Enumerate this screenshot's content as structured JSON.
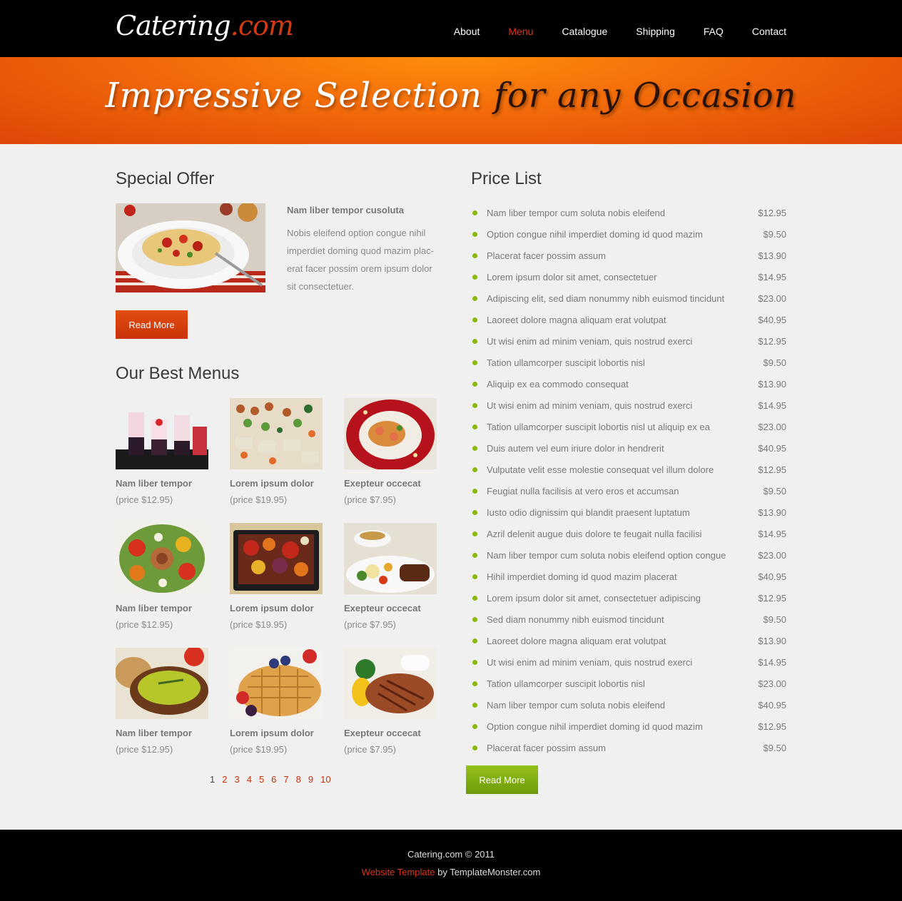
{
  "header": {
    "logo_main": "Catering",
    "logo_suffix": ".com",
    "nav": [
      {
        "label": "About",
        "active": false
      },
      {
        "label": "Menu",
        "active": true
      },
      {
        "label": "Catalogue",
        "active": false
      },
      {
        "label": "Shipping",
        "active": false
      },
      {
        "label": "FAQ",
        "active": false
      },
      {
        "label": "Contact",
        "active": false
      }
    ]
  },
  "banner": {
    "part1": "Impressive Selection",
    "part2": "for any Occasion"
  },
  "special_offer": {
    "heading": "Special Offer",
    "title": "Nam liber tempor cusoluta",
    "text": "Nobis eleifend option congue nihil imperdiet doming quod mazim plac-erat facer possim orem ipsum dolor sit consectetuer.",
    "button": "Read More"
  },
  "best_menus": {
    "heading": "Our Best Menus",
    "items": [
      {
        "name": "Nam liber tempor",
        "price": "(price $12.95)",
        "image": "dessert-glasses"
      },
      {
        "name": "Lorem ipsum dolor",
        "price": "(price $19.95)",
        "image": "canape-platter"
      },
      {
        "name": "Exepteur occecat",
        "price": "(price $7.95)",
        "image": "shrimp-plate"
      },
      {
        "name": "Nam liber tempor",
        "price": "(price $12.95)",
        "image": "vegetable-salad"
      },
      {
        "name": "Lorem ipsum dolor",
        "price": "(price $19.95)",
        "image": "roasted-vegetables"
      },
      {
        "name": "Exepteur occecat",
        "price": "(price $7.95)",
        "image": "steak-gravy"
      },
      {
        "name": "Nam liber tempor",
        "price": "(price $12.95)",
        "image": "green-soup"
      },
      {
        "name": "Lorem ipsum dolor",
        "price": "(price $19.95)",
        "image": "waffles-berries"
      },
      {
        "name": "Exepteur occecat",
        "price": "(price $7.95)",
        "image": "grilled-chicken"
      }
    ],
    "pages": [
      "1",
      "2",
      "3",
      "4",
      "5",
      "6",
      "7",
      "8",
      "9",
      "10"
    ],
    "current_page": "1"
  },
  "price_list": {
    "heading": "Price List",
    "items": [
      {
        "name": "Nam liber tempor cum soluta nobis eleifend",
        "price": "$12.95"
      },
      {
        "name": "Option congue nihil imperdiet doming id quod mazim",
        "price": "$9.50"
      },
      {
        "name": "Placerat facer possim assum",
        "price": "$13.90"
      },
      {
        "name": "Lorem ipsum dolor sit amet, consectetuer",
        "price": "$14.95"
      },
      {
        "name": "Adipiscing elit, sed diam nonummy nibh euismod tincidunt",
        "price": "$23.00"
      },
      {
        "name": "Laoreet dolore magna aliquam erat volutpat",
        "price": "$40.95"
      },
      {
        "name": "Ut wisi enim ad minim veniam, quis nostrud exerci",
        "price": "$12.95"
      },
      {
        "name": "Tation ullamcorper suscipit lobortis nisl",
        "price": "$9.50"
      },
      {
        "name": "Aliquip ex ea commodo consequat",
        "price": "$13.90"
      },
      {
        "name": "Ut wisi enim ad minim veniam, quis nostrud exerci",
        "price": "$14.95"
      },
      {
        "name": "Tation ullamcorper suscipit lobortis nisl ut aliquip ex ea",
        "price": "$23.00"
      },
      {
        "name": "Duis autem vel eum iriure dolor in hendrerit",
        "price": "$40.95"
      },
      {
        "name": "Vulputate velit esse molestie consequat vel illum dolore",
        "price": "$12.95"
      },
      {
        "name": "Feugiat nulla facilisis at vero eros et accumsan",
        "price": "$9.50"
      },
      {
        "name": "Iusto odio dignissim qui blandit praesent luptatum",
        "price": "$13.90"
      },
      {
        "name": "Azril delenit augue duis dolore te feugait nulla facilisi",
        "price": "$14.95"
      },
      {
        "name": "Nam liber tempor cum soluta nobis eleifend option congue",
        "price": "$23.00"
      },
      {
        "name": "Hihil imperdiet doming id quod mazim placerat",
        "price": "$40.95"
      },
      {
        "name": "Lorem ipsum dolor sit amet, consectetuer adipiscing",
        "price": "$12.95"
      },
      {
        "name": "Sed diam nonummy nibh euismod tincidunt",
        "price": "$9.50"
      },
      {
        "name": "Laoreet dolore magna aliquam erat volutpat",
        "price": "$13.90"
      },
      {
        "name": "Ut wisi enim ad minim veniam, quis nostrud exerci",
        "price": "$14.95"
      },
      {
        "name": "Tation ullamcorper suscipit lobortis nisl",
        "price": "$23.00"
      },
      {
        "name": "Nam liber tempor cum soluta nobis eleifend",
        "price": "$40.95"
      },
      {
        "name": "Option congue nihil imperdiet doming id quod mazim",
        "price": "$12.95"
      },
      {
        "name": "Placerat facer possim assum",
        "price": "$9.50"
      }
    ],
    "button": "Read More"
  },
  "footer": {
    "copyright": "Catering.com © 2011",
    "link_text": "Website Template",
    "by_text": " by TemplateMonster.com"
  },
  "colors": {
    "accent_red": "#c2320e",
    "accent_green": "#8ab80e",
    "banner_orange": "#f26a0a"
  }
}
